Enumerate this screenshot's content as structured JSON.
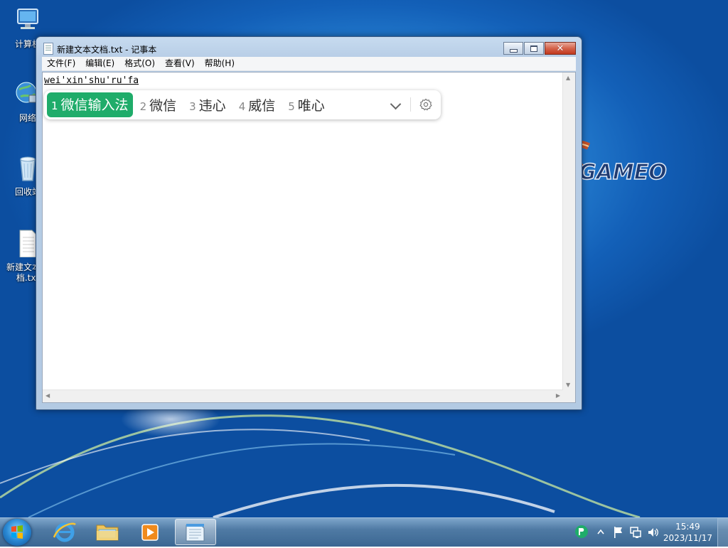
{
  "desktop": {
    "icons": [
      {
        "label": "计算机"
      },
      {
        "label": "网络"
      },
      {
        "label": "回收站"
      },
      {
        "label": "新建文本文档.txt"
      }
    ]
  },
  "window": {
    "title": "新建文本文档.txt - 记事本",
    "close_glyph": "✕",
    "menu": [
      "文件(F)",
      "编辑(E)",
      "格式(O)",
      "查看(V)",
      "帮助(H)"
    ],
    "content": "wei'xin'shu'ru'fa"
  },
  "ime": {
    "candidates": [
      {
        "num": "1",
        "text": "微信输入法",
        "selected": true
      },
      {
        "num": "2",
        "text": "微信"
      },
      {
        "num": "3",
        "text": "违心"
      },
      {
        "num": "4",
        "text": "威信"
      },
      {
        "num": "5",
        "text": "唯心"
      }
    ],
    "accent_color": "#1fac6a"
  },
  "watermark": {
    "text": "GAMEO"
  },
  "taskbar": {
    "clock_time": "15:49",
    "clock_date": "2023/11/17"
  }
}
